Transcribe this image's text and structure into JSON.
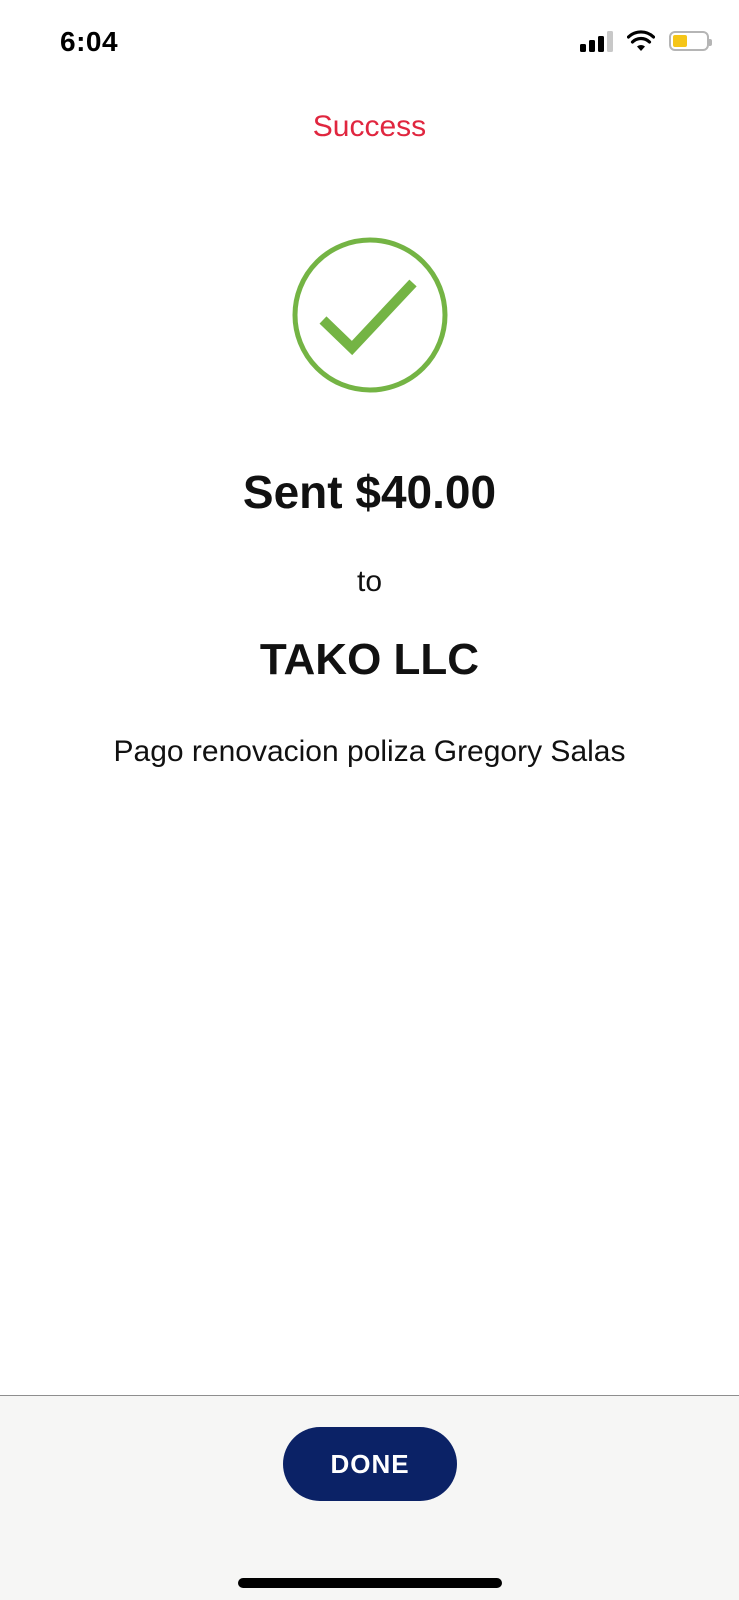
{
  "status_bar": {
    "time": "6:04",
    "icons": [
      "signal-icon",
      "wifi-icon",
      "battery-icon"
    ],
    "battery_color": "#f5c518"
  },
  "header": {
    "title": "Success",
    "title_color": "#e0263f"
  },
  "confirmation": {
    "icon": "check-circle-icon",
    "icon_color": "#74b444",
    "amount_text": "Sent $40.00",
    "to_label": "to",
    "recipient": "TAKO LLC",
    "memo": "Pago renovacion poliza Gregory Salas"
  },
  "footer": {
    "done_label": "DONE",
    "button_color": "#0b2266"
  }
}
